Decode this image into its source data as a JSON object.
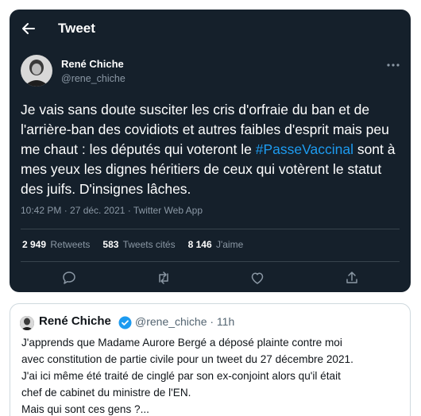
{
  "header": {
    "title": "Tweet"
  },
  "tweet": {
    "author_name": "René Chiche",
    "author_handle": "@rene_chiche",
    "text_before": "Je vais sans doute susciter les cris d'orfraie du ban et de l'arrière-ban des covidiots et autres faibles d'esprit mais peu me chaut : les députés qui voteront le ",
    "hashtag": "#PasseVaccinal",
    "text_after": " sont à mes yeux les dignes héritiers de ceux qui votèrent le statut des juifs. D'insignes lâches.",
    "meta": "10:42 PM · 27 déc. 2021 · Twitter Web App",
    "stats": {
      "retweets_count": "2 949",
      "retweets_label": "Retweets",
      "quotes_count": "583",
      "quotes_label": "Tweets cités",
      "likes_count": "8 146",
      "likes_label": "J'aime"
    }
  },
  "quote": {
    "author_name": "René Chiche",
    "author_handle_time": "@rene_chiche · 11h",
    "lines": [
      "J'apprends que Madame Aurore Bergé a déposé plainte contre moi",
      "avec constitution de partie civile pour un tweet du 27 décembre 2021.",
      "J'ai ici même été traité de cinglé par son ex-conjoint alors qu'il était",
      "chef de cabinet du ministre de l'EN.",
      "Mais qui sont ces gens ?..."
    ]
  },
  "colors": {
    "dark_bg": "#15202b",
    "accent": "#1d9bf0",
    "muted": "#8b98a5"
  },
  "icons": [
    "back-arrow-icon",
    "more-icon",
    "reply-icon",
    "retweet-icon",
    "like-icon",
    "share-icon",
    "verified-badge-icon"
  ]
}
